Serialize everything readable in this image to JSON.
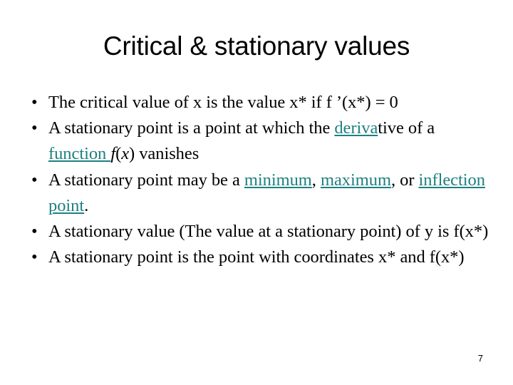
{
  "slide": {
    "title": "Critical & stationary values",
    "page_number": "7",
    "link_color": "#1f8080",
    "text_color": "#000000",
    "background_color": "#ffffff",
    "bullet_glyph": "•",
    "bullets": [
      {
        "id": "critical-value",
        "runs": [
          {
            "text": "The critical value of x is the value x* if f ’(x*) = 0",
            "link": false,
            "italic": false
          }
        ]
      },
      {
        "id": "stationary-point-definition",
        "runs": [
          {
            "text": "A stationary point is a point at which the ",
            "link": false,
            "italic": false
          },
          {
            "text": "deriva",
            "link": true,
            "italic": false
          },
          {
            "text": "tive of a ",
            "link": false,
            "italic": false
          },
          {
            "text": "function ",
            "link": true,
            "italic": false
          },
          {
            "text": "f",
            "link": false,
            "italic": true
          },
          {
            "text": "(",
            "link": false,
            "italic": false
          },
          {
            "text": "x",
            "link": false,
            "italic": true
          },
          {
            "text": ") vanishes",
            "link": false,
            "italic": false
          }
        ]
      },
      {
        "id": "stationary-point-kinds",
        "runs": [
          {
            "text": "A stationary point may be a ",
            "link": false,
            "italic": false
          },
          {
            "text": "minimum",
            "link": true,
            "italic": false
          },
          {
            "text": ", ",
            "link": false,
            "italic": false
          },
          {
            "text": "maximum",
            "link": true,
            "italic": false
          },
          {
            "text": ", or ",
            "link": false,
            "italic": false
          },
          {
            "text": "inflection point",
            "link": true,
            "italic": false
          },
          {
            "text": ".",
            "link": false,
            "italic": false
          }
        ]
      },
      {
        "id": "stationary-value",
        "runs": [
          {
            "text": "A stationary value (The value at a stationary point)  of y is f(x*)",
            "link": false,
            "italic": false
          }
        ]
      },
      {
        "id": "stationary-point-coordinates",
        "runs": [
          {
            "text": "A stationary point is the point with coordinates x* and f(x*)",
            "link": false,
            "italic": false
          }
        ]
      }
    ]
  }
}
